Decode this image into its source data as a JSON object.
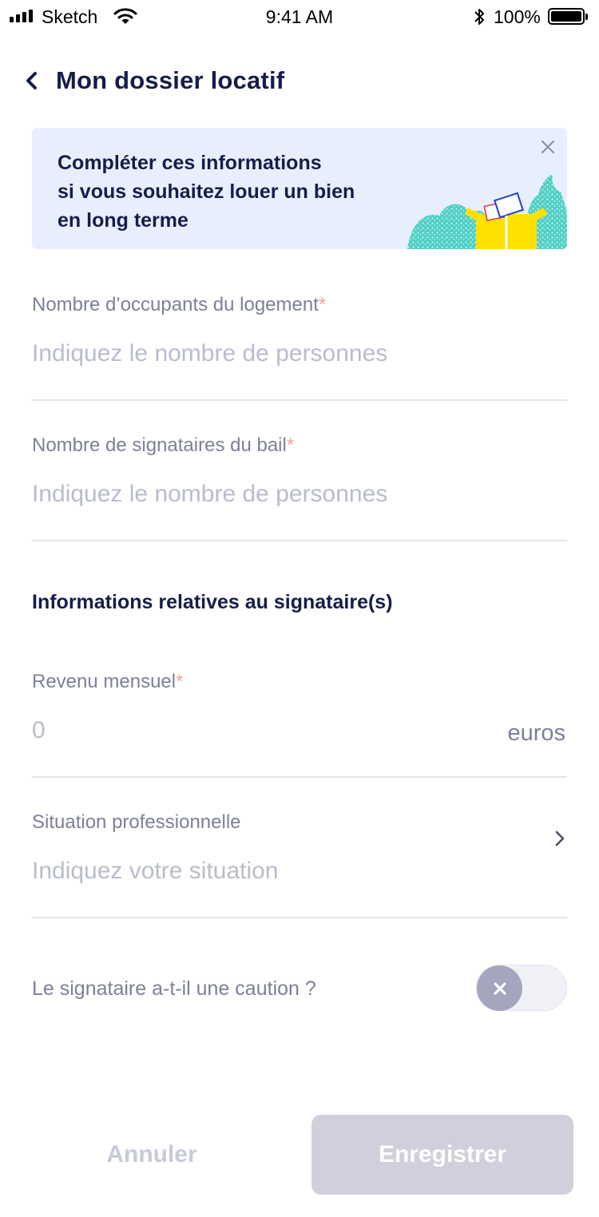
{
  "status_bar": {
    "carrier": "Sketch",
    "time": "9:41 AM",
    "battery": "100%",
    "icons": [
      "signal-icon",
      "wifi-icon",
      "bluetooth-icon",
      "battery-icon"
    ]
  },
  "header": {
    "title": "Mon dossier locatif",
    "back_icon": "chevron-left-icon"
  },
  "banner": {
    "lines": [
      "Compléter ces informations",
      "si vous souhaitez louer un bien",
      "en long terme"
    ],
    "close_icon": "close-icon",
    "illustration": "open-box-illustration"
  },
  "fields": {
    "occupants": {
      "label": "Nombre d’occupants du logement",
      "required": "*",
      "placeholder": "Indiquez le nombre de personnes",
      "value": ""
    },
    "signataires": {
      "label": "Nombre de signataires du bail",
      "required": "*",
      "placeholder": "Indiquez le nombre de personnes",
      "value": ""
    },
    "revenu": {
      "label": "Revenu mensuel",
      "required": "*",
      "placeholder": "0",
      "value": "",
      "suffix": "euros"
    },
    "situation": {
      "label": "Situation professionnelle",
      "placeholder": "Indiquez votre situation",
      "value": ""
    }
  },
  "section": {
    "title": "Informations relatives au signataire(s)"
  },
  "caution": {
    "label": "Le signataire a-t-il une caution ?",
    "value": false
  },
  "actions": {
    "cancel_label": "Annuler",
    "save_label": "Enregistrer"
  },
  "colors": {
    "primary_text": "#161d4a",
    "label_text": "#7d8096",
    "placeholder": "#b9bccb",
    "banner_bg": "#e8effc",
    "required": "#f0a0a0",
    "save_disabled": "#cfd0dc",
    "illustration_teal": "#4fd1c5",
    "illustration_yellow": "#ffe100",
    "illustration_blue": "#1f3fe0"
  }
}
